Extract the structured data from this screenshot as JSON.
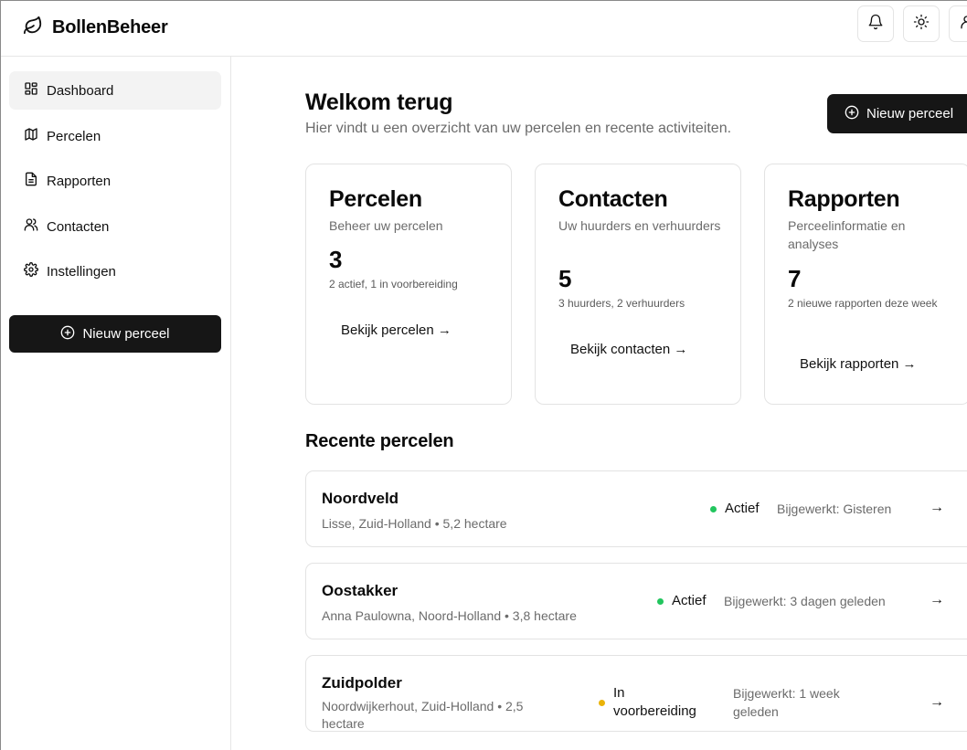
{
  "header": {
    "brand": "BollenBeheer",
    "icons": [
      "leaf-icon",
      "bell-icon",
      "sun-icon",
      "user-icon"
    ]
  },
  "sidebar": {
    "items": [
      {
        "label": "Dashboard",
        "icon": "grid-icon",
        "active": true
      },
      {
        "label": "Percelen",
        "icon": "map-icon",
        "active": false
      },
      {
        "label": "Rapporten",
        "icon": "file-icon",
        "active": false
      },
      {
        "label": "Contacten",
        "icon": "users-icon",
        "active": false
      },
      {
        "label": "Instellingen",
        "icon": "gear-icon",
        "active": false
      }
    ],
    "new_button": "Nieuw perceel"
  },
  "main": {
    "title": "Welkom terug",
    "subtitle": "Hier vindt u een overzicht van uw percelen en recente activiteiten.",
    "new_button": "Nieuw perceel",
    "cards": [
      {
        "title": "Percelen",
        "description": "Beheer uw percelen",
        "value": "3",
        "note": "2 actief, 1 in voorbereiding",
        "link": "Bekijk percelen →"
      },
      {
        "title": "Contacten",
        "description": "Uw huurders en verhuurders",
        "value": "5",
        "note": "3 huurders, 2 verhuurders",
        "link": "Bekijk contacten →"
      },
      {
        "title": "Rapporten",
        "description": "Perceelinformatie en analyses",
        "value": "7",
        "note": "2 nieuwe rapporten deze week",
        "link": "Bekijk rapporten →"
      }
    ],
    "recent_title": "Recente percelen",
    "recent": [
      {
        "name": "Noordveld",
        "location": "Lisse, Zuid-Holland • 5,2 hectare",
        "status": "Actief",
        "status_color": "#22c55e",
        "updated": "Bijgewerkt: Gisteren",
        "arrow": "→"
      },
      {
        "name": "Oostakker",
        "location": "Anna Paulowna, Noord-Holland • 3,8 hectare",
        "status": "Actief",
        "status_color": "#22c55e",
        "updated": "Bijgewerkt: 3 dagen geleden",
        "arrow": "→"
      },
      {
        "name": "Zuidpolder",
        "location": "Noordwijkerhout, Zuid-Holland • 2,5 hectare",
        "status": "In voorbereiding",
        "status_color": "#eab308",
        "updated": "Bijgewerkt: 1 week geleden",
        "arrow": "→"
      }
    ]
  }
}
